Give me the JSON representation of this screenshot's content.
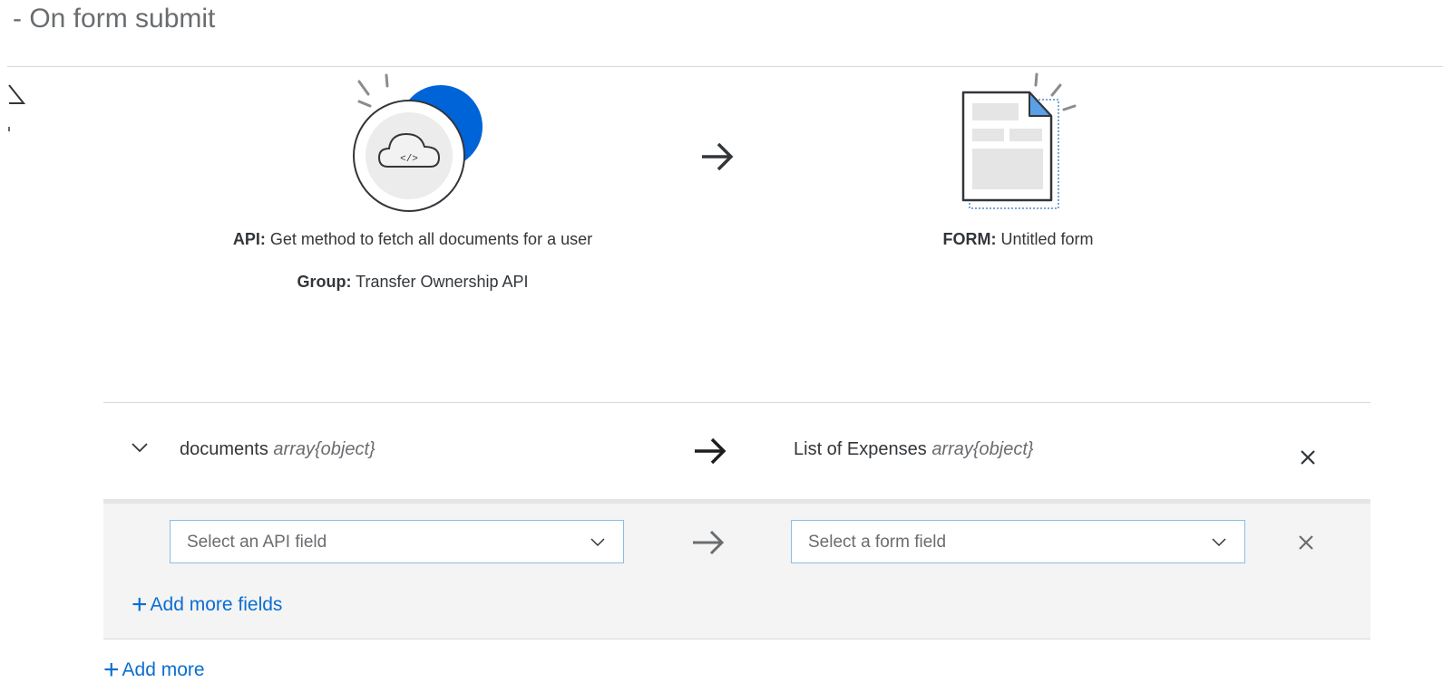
{
  "header": {
    "title": "- On form submit"
  },
  "source": {
    "api_label": "API:",
    "api_value": "Get method to fetch all documents for a user",
    "group_label": "Group:",
    "group_value": "Transfer Ownership API",
    "icon": "cloud-api-icon",
    "code_glyph": "</>"
  },
  "target": {
    "form_label": "FORM:",
    "form_value": "Untitled form",
    "icon": "document-form-icon"
  },
  "mapping": {
    "left_field": {
      "name": "documents",
      "type": "array{object}"
    },
    "right_field": {
      "name": "List of Expenses",
      "type": "array{object}"
    },
    "api_select": {
      "placeholder": "Select an API field"
    },
    "form_select": {
      "placeholder": "Select a form field"
    },
    "add_fields_label": "Add more fields"
  },
  "footer": {
    "add_more_label": "Add more"
  },
  "colors": {
    "accent": "#0a6ed1",
    "illustration_blue": "#0064d9",
    "text": "#32363a",
    "muted": "#6a6d70"
  }
}
